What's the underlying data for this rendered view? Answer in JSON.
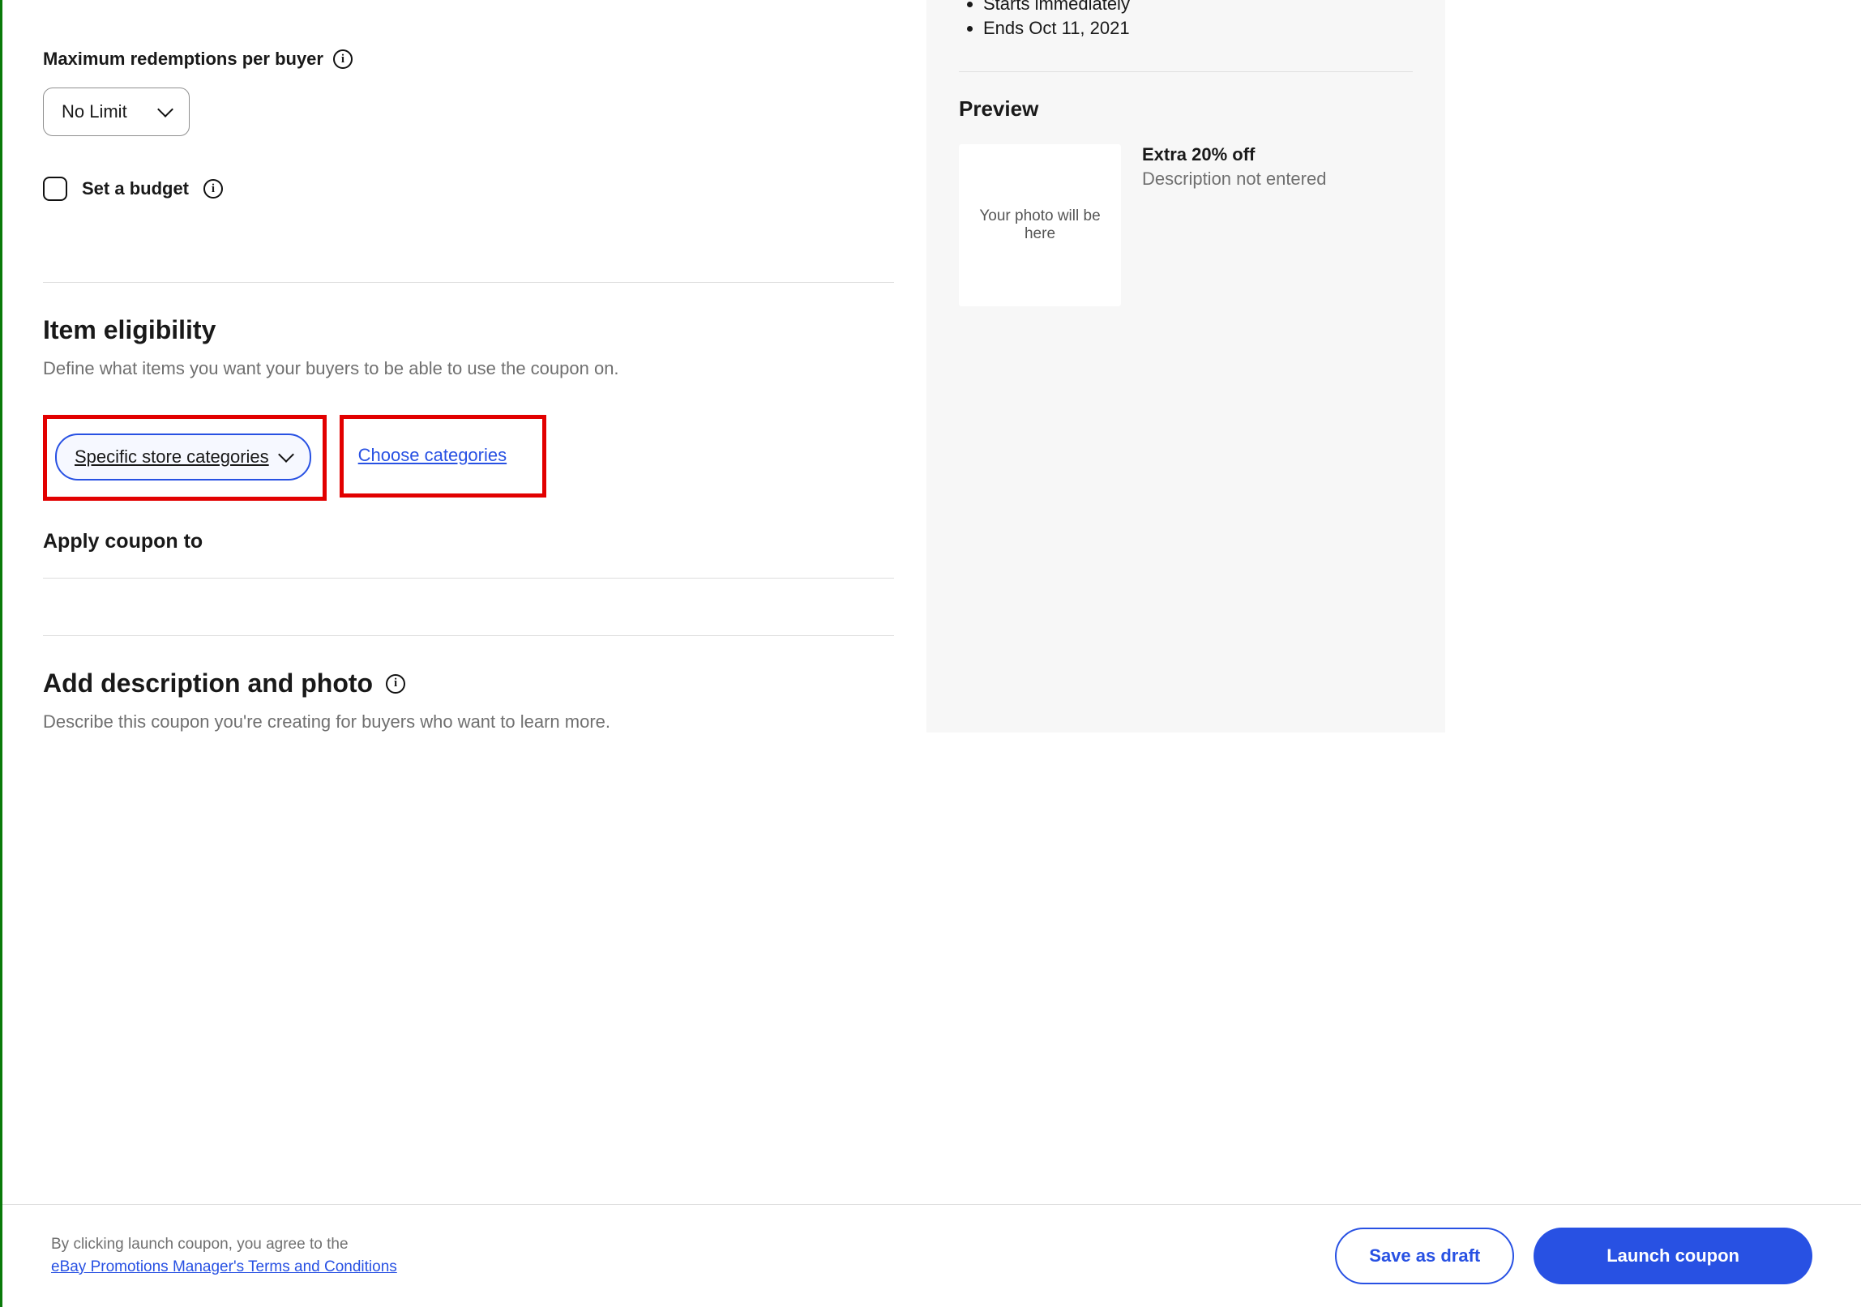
{
  "redemptions": {
    "label": "Maximum redemptions per buyer",
    "value": "No Limit"
  },
  "budget": {
    "label": "Set a budget"
  },
  "eligibility": {
    "title": "Item eligibility",
    "subtitle": "Define what items you want your buyers to be able to use the coupon on.",
    "select_value": "Specific store categories",
    "choose_link": "Choose categories",
    "apply_title": "Apply coupon to"
  },
  "description_section": {
    "title": "Add description and photo",
    "subtitle": "Describe this coupon you're creating for buyers who want to learn more."
  },
  "sidebar": {
    "bullets": [
      "Starts immediately",
      "Ends Oct 11, 2021"
    ],
    "preview_title": "Preview",
    "photo_placeholder": "Your photo will be here",
    "offer_headline": "Extra 20% off",
    "offer_desc": "Description not entered"
  },
  "footer": {
    "agree_text": "By clicking launch coupon, you agree to the",
    "terms_link": "eBay Promotions Manager's Terms and Conditions",
    "save_label": "Save as draft",
    "launch_label": "Launch coupon"
  }
}
